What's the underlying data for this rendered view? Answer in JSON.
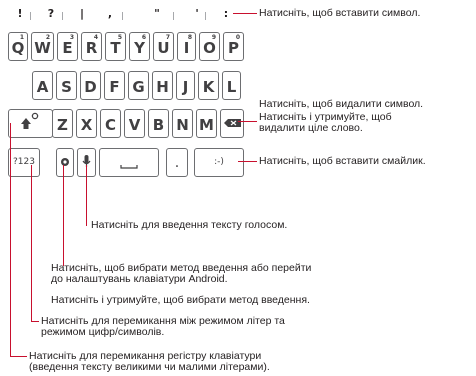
{
  "symbols_row": [
    "!",
    "?",
    "|",
    ",",
    "\"",
    "'",
    ":"
  ],
  "keyboard": {
    "row1": [
      {
        "label": "Q",
        "sup": "1"
      },
      {
        "label": "W",
        "sup": "2"
      },
      {
        "label": "E",
        "sup": "3"
      },
      {
        "label": "R",
        "sup": "4"
      },
      {
        "label": "T",
        "sup": "5"
      },
      {
        "label": "Y",
        "sup": "6"
      },
      {
        "label": "U",
        "sup": "7"
      },
      {
        "label": "I",
        "sup": "8"
      },
      {
        "label": "O",
        "sup": "9"
      },
      {
        "label": "P",
        "sup": "0"
      }
    ],
    "row2": [
      "A",
      "S",
      "D",
      "F",
      "G",
      "H",
      "J",
      "K",
      "L"
    ],
    "row3": [
      "Z",
      "X",
      "C",
      "V",
      "B",
      "N",
      "M"
    ],
    "mode_key_label": "?123",
    "smiley_key_label": ":-)",
    "period_key_label": "."
  },
  "annotations": {
    "insert_symbol": "Натисніть, щоб вставити символ.",
    "delete": [
      "Натисніть, щоб видалити символ.",
      "Натисніть і утримуйте, щоб",
      "видалити ціле слово."
    ],
    "insert_smiley": "Натисніть, щоб вставити смайлик.",
    "voice": "Натисніть для введення тексту голосом.",
    "input_method": [
      "Натисніть, щоб вибрати метод введення або перейти",
      "до налаштувань клавіатури Android."
    ],
    "hold_input_method": "Натисніть і утримуйте, щоб вибрати метод введення.",
    "mode_switch": [
      "Натисніть для перемикання між режимом літер та",
      "режимом цифр/символів."
    ],
    "shift": [
      "Натисніть для перемикання регістру клавіатури",
      "(введення тексту великими чи малими літерами)."
    ]
  },
  "colors": {
    "leader": "#c8102e",
    "key_border": "#6d6e71"
  }
}
